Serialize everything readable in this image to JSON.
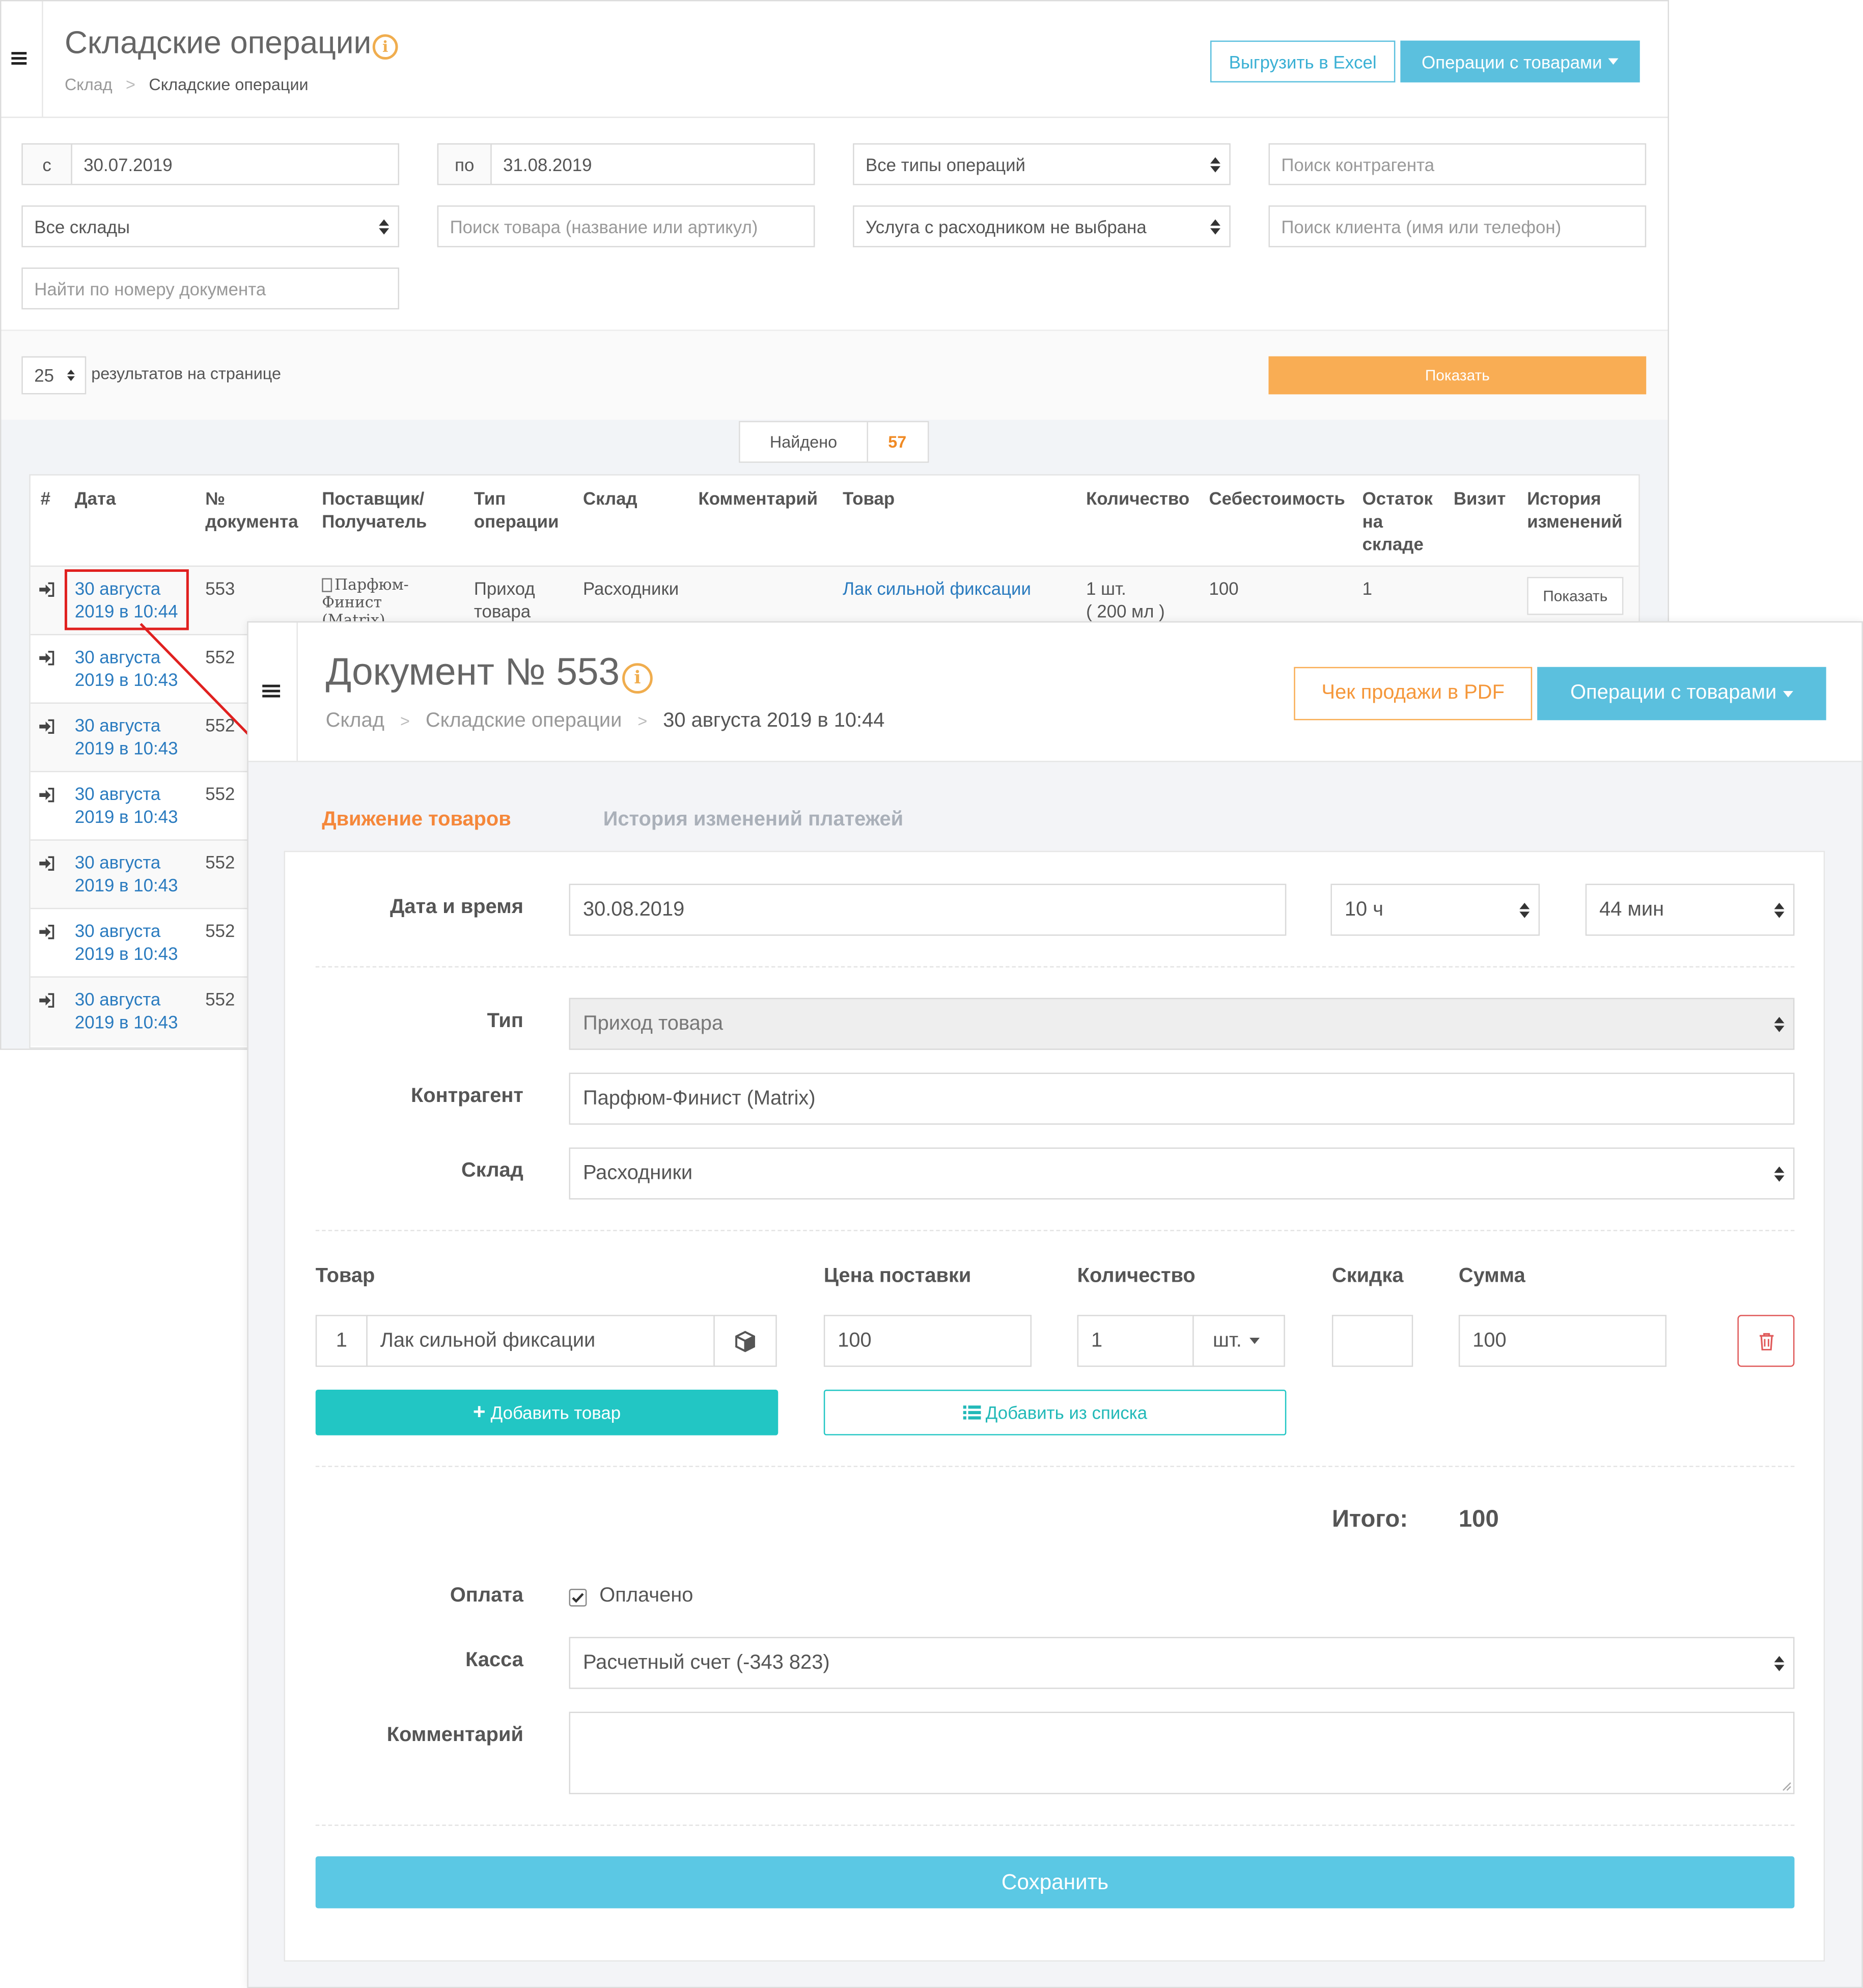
{
  "back": {
    "title": "Складские операции",
    "breadcrumb": [
      "Склад",
      "Складские операции"
    ],
    "export_button": "Выгрузить в Excel",
    "ops_button": "Операции с товарами",
    "filters": {
      "from_prefix": "с",
      "from_date": "30.07.2019",
      "to_prefix": "по",
      "to_date": "31.08.2019",
      "op_types": "Все типы операций",
      "counterparty_placeholder": "Поиск контрагента",
      "warehouses": "Все склады",
      "product_placeholder": "Поиск товара (название или артикул)",
      "service": "Услуга с расходником не выбрана",
      "client_placeholder": "Поиск клиента (имя или телефон)",
      "doc_placeholder": "Найти по номеру документа"
    },
    "per_page": "25",
    "per_page_label": "результатов на странице",
    "show_button": "Показать",
    "found_label": "Найдено",
    "found_count": "57",
    "table": {
      "headers": {
        "num": "#",
        "date": "Дата",
        "doc": "№ документа",
        "supplier": "Поставщик/ Получатель",
        "type": "Тип операции",
        "warehouse": "Склад",
        "comment": "Комментарий",
        "product": "Товар",
        "qty": "Количество",
        "cost": "Себестоимость",
        "stock": "Остаток на складе",
        "visit": "Визит",
        "history": "История изменений"
      },
      "first_row": {
        "date": "30 августа 2019 в 10:44",
        "doc": "553",
        "supplier": "Парфюм-Финист (Matrix)",
        "type": "Приход товара",
        "warehouse": "Расходники",
        "product": "Лак сильной фиксации",
        "qty": "1 шт.",
        "qty_volume": "( 200 мл )",
        "cost": "100",
        "stock": "1",
        "history_button": "Показать"
      },
      "rows": [
        {
          "date": "30 августа 2019 в 10:43",
          "doc": "552"
        },
        {
          "date": "30 августа 2019 в 10:43",
          "doc": "552"
        },
        {
          "date": "30 августа 2019 в 10:43",
          "doc": "552"
        },
        {
          "date": "30 августа 2019 в 10:43",
          "doc": "552"
        },
        {
          "date": "30 августа 2019 в 10:43",
          "doc": "552"
        },
        {
          "date": "30 августа 2019 в 10:43",
          "doc": "552"
        }
      ]
    }
  },
  "doc": {
    "title": "Документ № 553",
    "breadcrumb": [
      "Склад",
      "Складские операции",
      "30 августа 2019 в 10:44"
    ],
    "pdf_button": "Чек продажи в PDF",
    "ops_button": "Операции с товарами",
    "tabs": [
      "Движение товаров",
      "История изменений платежей"
    ],
    "form": {
      "datetime_label": "Дата и время",
      "date": "30.08.2019",
      "hours": "10 ч",
      "minutes": "44 мин",
      "type_label": "Тип",
      "type": "Приход товара",
      "counterparty_label": "Контрагент",
      "counterparty": "Парфюм-Финист (Matrix)",
      "warehouse_label": "Склад",
      "warehouse": "Расходники",
      "col_product": "Товар",
      "col_price": "Цена поставки",
      "col_qty": "Количество",
      "col_discount": "Скидка",
      "col_sum": "Сумма",
      "item_index": "1",
      "item_name": "Лак сильной фиксации",
      "item_price": "100",
      "item_qty": "1",
      "item_unit": "шт.",
      "item_discount": "",
      "item_sum": "100",
      "add_product": "Добавить товар",
      "add_from_list": "Добавить из списка",
      "total_label": "Итого:",
      "total": "100",
      "payment_label": "Оплата",
      "paid_label": "Оплачено",
      "cash_label": "Касса",
      "cash": "Расчетный счет (-343 823)",
      "comment_label": "Комментарий",
      "comment": "",
      "save_button": "Сохранить"
    }
  },
  "colors": {
    "accent_blue": "#5bc0de",
    "orange": "#f9ad54",
    "teal": "#22c6c4",
    "link": "#2a7bbf",
    "highlight_red": "#e0201f"
  }
}
